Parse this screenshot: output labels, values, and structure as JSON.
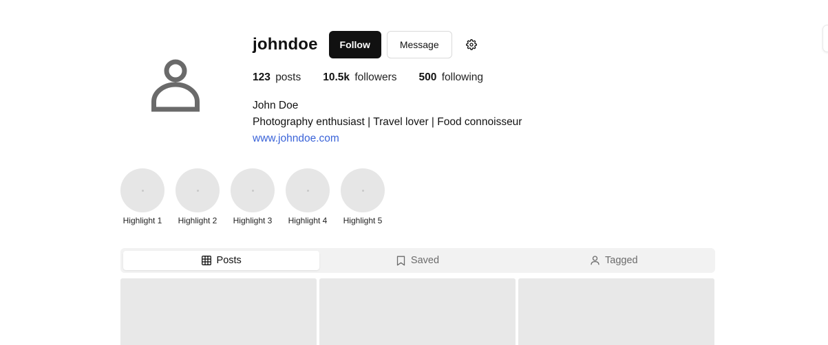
{
  "profile": {
    "username": "johndoe",
    "follow_label": "Follow",
    "message_label": "Message",
    "settings_icon": "gear-icon",
    "avatar_icon": "user-icon",
    "stats": [
      {
        "value": "123",
        "label": "posts"
      },
      {
        "value": "10.5k",
        "label": "followers"
      },
      {
        "value": "500",
        "label": "following"
      }
    ],
    "full_name": "John Doe",
    "bio": "Photography enthusiast | Travel lover | Food connoisseur",
    "website": "www.johndoe.com"
  },
  "highlights": [
    {
      "label": "Highlight 1"
    },
    {
      "label": "Highlight 2"
    },
    {
      "label": "Highlight 3"
    },
    {
      "label": "Highlight 4"
    },
    {
      "label": "Highlight 5"
    }
  ],
  "tabs": [
    {
      "label": "Posts",
      "icon": "grid-icon",
      "active": true
    },
    {
      "label": "Saved",
      "icon": "bookmark-icon",
      "active": false
    },
    {
      "label": "Tagged",
      "icon": "user-icon",
      "active": false
    }
  ],
  "colors": {
    "primary_button": "#111111",
    "link": "#3a63d8",
    "placeholder": "#e6e6e6"
  }
}
